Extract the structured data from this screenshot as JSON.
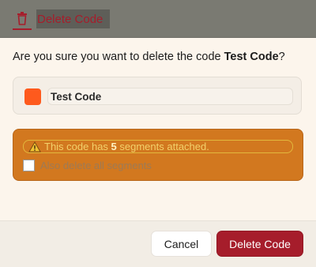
{
  "dialog": {
    "title": "Delete Code",
    "title_icon": "trash-icon",
    "prompt_prefix": "Are you sure you want to delete the code ",
    "prompt_code": "Test Code",
    "prompt_suffix": "?"
  },
  "code": {
    "name": "Test Code",
    "color": "#fe5a1d"
  },
  "warning": {
    "icon": "warning-icon",
    "text_prefix": "This code has ",
    "segment_count": "5",
    "text_suffix": " segments attached.",
    "checkbox_label": "Also delete all segments",
    "checkbox_checked": false
  },
  "buttons": {
    "cancel_label": "Cancel",
    "delete_label": "Delete Code"
  },
  "colors": {
    "accent": "#a61d2b",
    "warning_bg": "#d2781f"
  }
}
